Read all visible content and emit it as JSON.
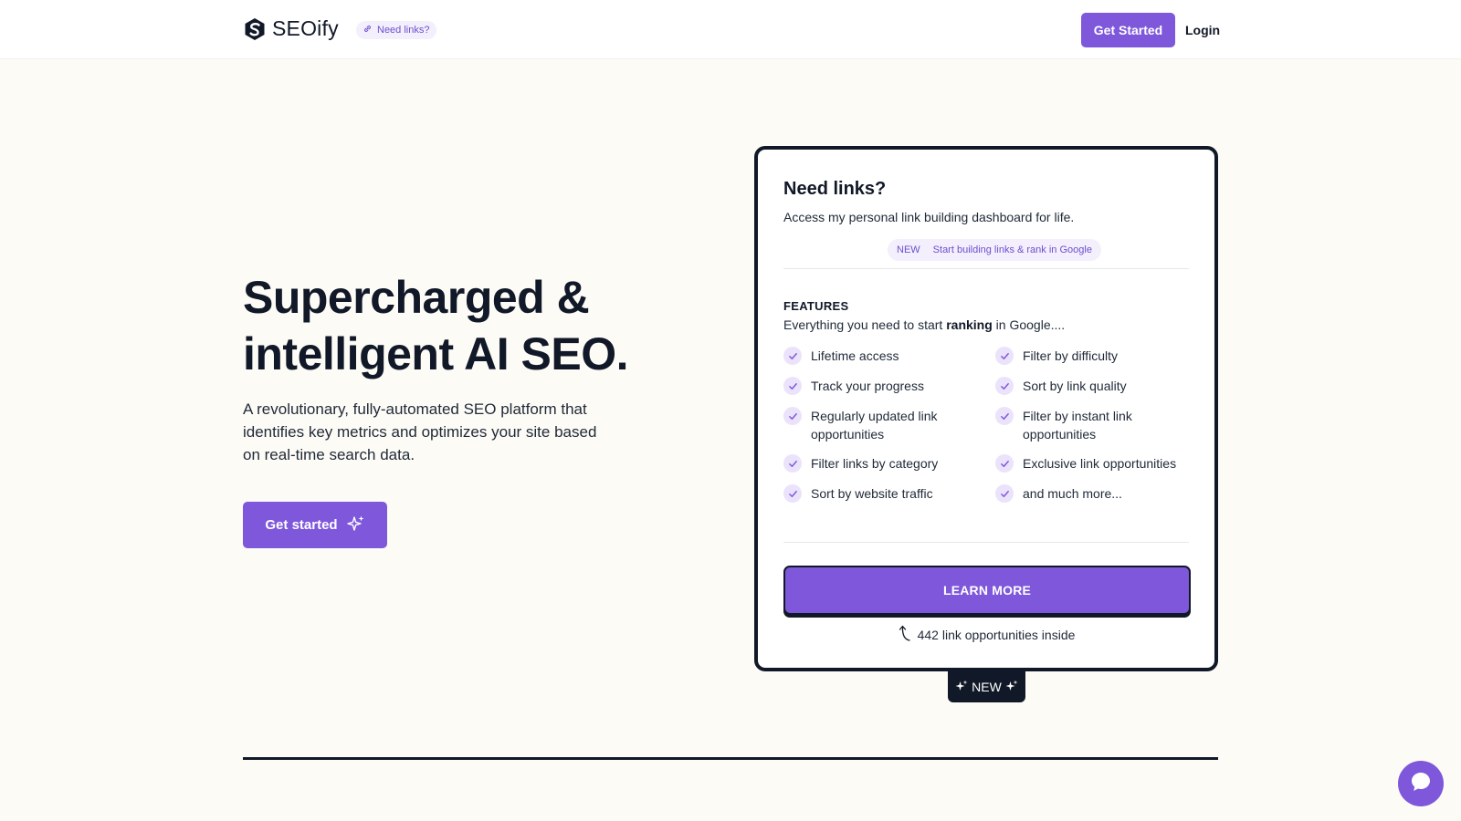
{
  "header": {
    "logo_text": "SEOify",
    "need_links_pill": "Need links?",
    "get_started": "Get Started",
    "login": "Login"
  },
  "hero": {
    "title": "Supercharged & intelligent AI SEO.",
    "subtitle": "A revolutionary, fully-automated SEO platform that identifies key metrics and optimizes your site based on real-time search data.",
    "cta": "Get started"
  },
  "card": {
    "title": "Need links?",
    "subtitle": "Access my personal link building dashboard for life.",
    "pill_tag": "NEW",
    "pill_text": "Start building links & rank in Google",
    "features_label": "FEATURES",
    "features_sub_before": "Everything you need to start ",
    "features_sub_bold": "ranking",
    "features_sub_after": " in Google....",
    "features_left": [
      "Lifetime access",
      "Track your progress",
      "Regularly updated link opportunities",
      "Filter links by category",
      "Sort by website traffic"
    ],
    "features_right": [
      "Filter by difficulty",
      "Sort by link quality",
      "Filter by instant link opportunities",
      "Exclusive link opportunities",
      "and much more..."
    ],
    "learn_more": "LEARN MORE",
    "opportunities": "442 link opportunities inside"
  },
  "badge": {
    "label": "NEW"
  },
  "colors": {
    "accent": "#7e57db",
    "dark": "#111827",
    "background": "#fdfbf6",
    "pill_bg": "#f3effc",
    "check_bg": "#ebe3fb"
  },
  "icons": {
    "logo": "seoify-logo-icon",
    "link": "link-icon",
    "sparkle": "sparkle-icon",
    "check": "check-icon",
    "arrow": "curved-arrow-up-icon",
    "chat": "chat-bubble-icon"
  }
}
